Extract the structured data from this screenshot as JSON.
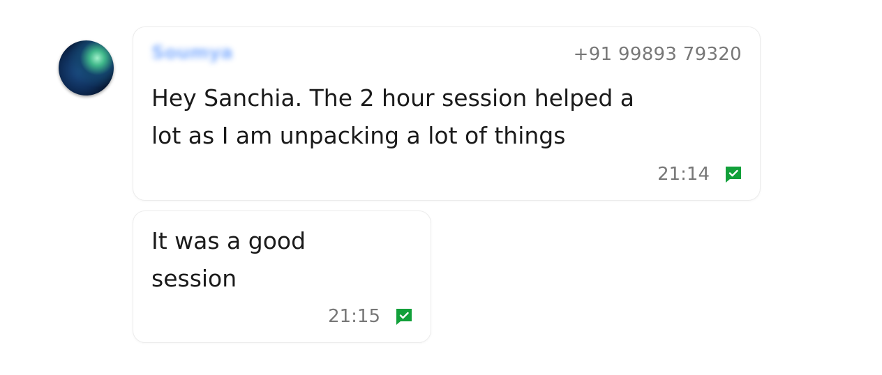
{
  "contact": {
    "avatar_icon": "globe-avatar",
    "name": "Soumya",
    "phone": "+91 99893 79320"
  },
  "messages": [
    {
      "text_line1": "Hey Sanchia. The 2 hour session helped a",
      "text_line2": "lot as I am unpacking a lot of things",
      "time": "21:14",
      "status_icon": "read-check-icon"
    },
    {
      "text_line1": "It was a good",
      "text_line2": "session",
      "time": "21:15",
      "status_icon": "read-check-icon"
    }
  ],
  "colors": {
    "check_green": "#12a03a",
    "text": "#1a1a1a",
    "meta": "#777777"
  }
}
